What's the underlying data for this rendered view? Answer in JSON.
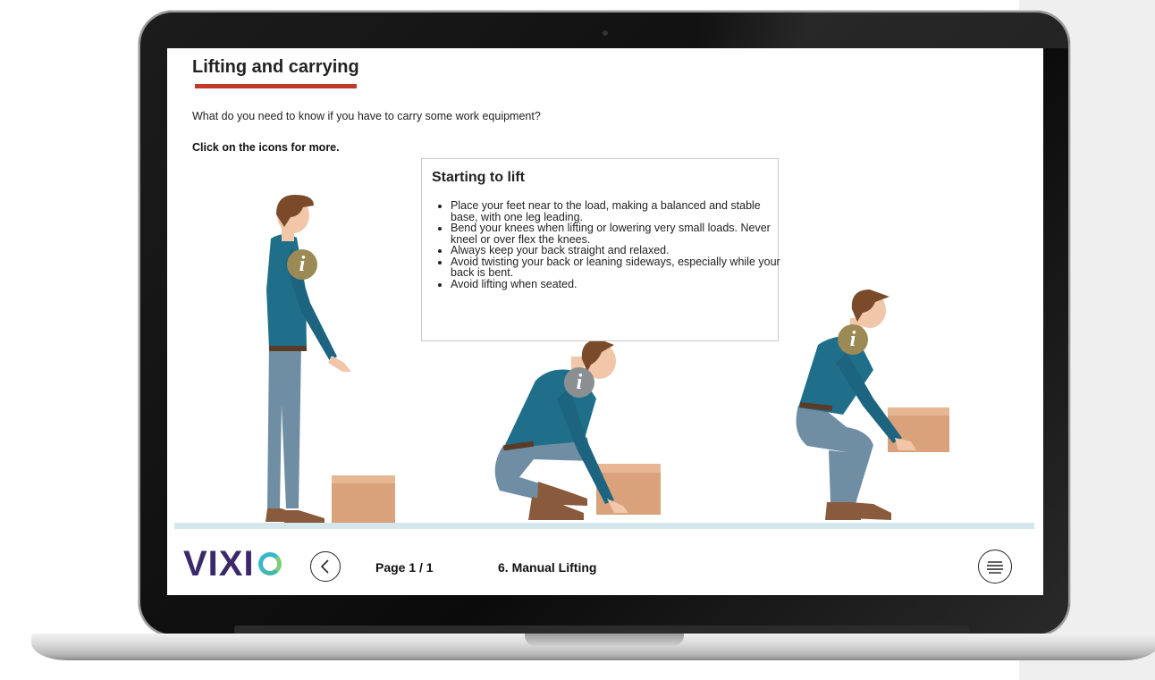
{
  "header": {
    "title": "Lifting and carrying",
    "intro": "What do you need to know if you have to carry some work equipment?",
    "instruction": "Click on the icons for more."
  },
  "popup": {
    "title": "Starting to lift",
    "items": [
      "Place your feet near to the load, making a balanced and stable base, with one leg leading.",
      "Bend your knees when lifting or lowering very small loads. Never kneel or over flex the knees.",
      "Always keep your back straight and relaxed.",
      "Avoid twisting your back or leaning sideways, especially while your back is bent.",
      "Avoid lifting when seated."
    ]
  },
  "info_icons": [
    {
      "glyph": "i",
      "state": "unvisited",
      "color": "#9b8a55"
    },
    {
      "glyph": "i",
      "state": "active",
      "color": "#8a8f92"
    },
    {
      "glyph": "i",
      "state": "unvisited",
      "color": "#9b8a55"
    }
  ],
  "footer": {
    "logo_text": "VIXI",
    "page_counter": "Page 1 / 1",
    "section_title": "6. Manual Lifting",
    "back_icon": "chevron-left-icon",
    "menu_icon": "menu-icon"
  },
  "colors": {
    "accent": "#c0392b",
    "logo": "#3b2a6b",
    "shirt": "#1f6f8b",
    "trousers": "#6f8ea3",
    "box": "#d9a27a",
    "floor": "#d5e6ec"
  }
}
